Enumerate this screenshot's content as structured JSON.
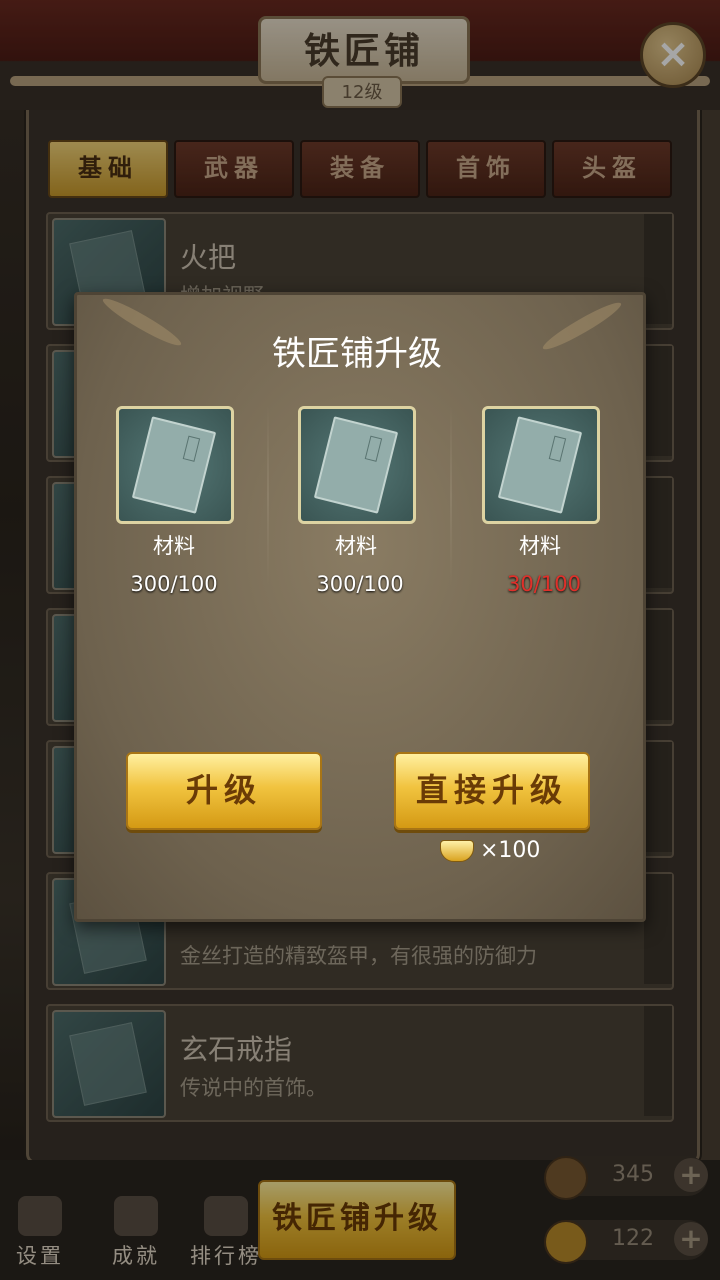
{
  "header": {
    "title": "铁匠铺",
    "level": "12级",
    "close_icon": "close-icon"
  },
  "tabs": [
    {
      "label": "基础",
      "active": true
    },
    {
      "label": "武器",
      "active": false
    },
    {
      "label": "装备",
      "active": false
    },
    {
      "label": "首饰",
      "active": false
    },
    {
      "label": "头盔",
      "active": false
    }
  ],
  "items": [
    {
      "name": "火把",
      "desc": "增加视野"
    },
    {
      "name": "",
      "desc": "金丝打造的精致盔甲，有很强的防御力"
    },
    {
      "name": "玄石戒指",
      "desc": "传说中的首饰。"
    }
  ],
  "dialog": {
    "title": "铁匠铺升级",
    "materials": [
      {
        "name": "材料",
        "count": "300/100",
        "sufficient": true
      },
      {
        "name": "材料",
        "count": "300/100",
        "sufficient": true
      },
      {
        "name": "材料",
        "count": "30/100",
        "sufficient": false
      }
    ],
    "upgrade_label": "升级",
    "direct_upgrade_label": "直接升级",
    "direct_cost": "×100",
    "cost_icon": "gold-ingot-icon",
    "colors": {
      "insufficient": "#e0302a",
      "button_gold": "#f1c33f"
    }
  },
  "bottom_nav": [
    {
      "label": "设置",
      "icon": "gear-icon"
    },
    {
      "label": "成就",
      "icon": "flag-icon"
    },
    {
      "label": "排行榜",
      "icon": "ranking-icon"
    }
  ],
  "bottom_button": "铁匠铺升级",
  "resources": [
    {
      "value": "345",
      "icon": "resource-icon"
    },
    {
      "value": "122",
      "icon": "gold-ingot-icon"
    }
  ]
}
